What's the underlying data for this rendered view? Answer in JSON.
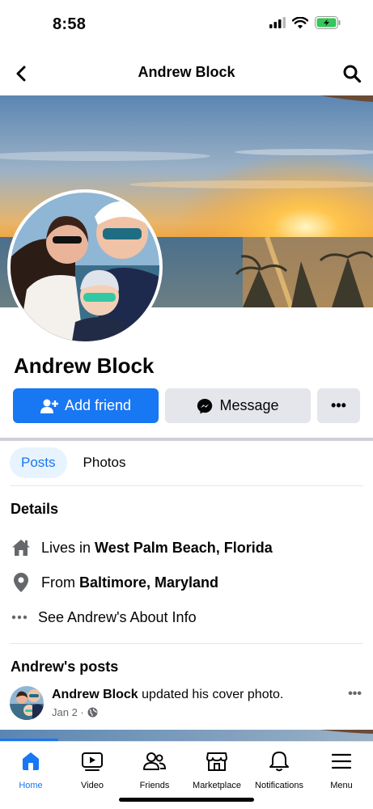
{
  "status": {
    "time": "8:58"
  },
  "header": {
    "title": "Andrew Block"
  },
  "profile": {
    "name": "Andrew Block"
  },
  "actions": {
    "add_friend": "Add friend",
    "message": "Message",
    "more": "•••"
  },
  "tabs": [
    {
      "label": "Posts"
    },
    {
      "label": "Photos"
    }
  ],
  "details": {
    "title": "Details",
    "lives_prefix": "Lives in",
    "lives_place": "West Palm Beach, Florida",
    "from_prefix": "From",
    "from_place": "Baltimore, Maryland",
    "about": "See Andrew's About Info"
  },
  "posts": {
    "title": "Andrew's posts",
    "item": {
      "author": "Andrew Block",
      "action": "updated his cover photo.",
      "date": "Jan 2 ·",
      "more": "•••"
    }
  },
  "bottom_nav": [
    {
      "label": "Home"
    },
    {
      "label": "Video"
    },
    {
      "label": "Friends"
    },
    {
      "label": "Marketplace"
    },
    {
      "label": "Notifications"
    },
    {
      "label": "Menu"
    }
  ],
  "colors": {
    "accent": "#1877f2",
    "button_gray": "#e4e6eb",
    "text": "#050505",
    "secondary_text": "#65676b",
    "battery": "#34c759"
  },
  "icons": [
    "back-arrow-icon",
    "search-icon",
    "add-person-icon",
    "messenger-icon",
    "home-icon",
    "location-pin-icon",
    "more-dots-icon",
    "globe-icon",
    "video-icon",
    "friends-icon",
    "marketplace-icon",
    "bell-icon",
    "menu-icon"
  ]
}
